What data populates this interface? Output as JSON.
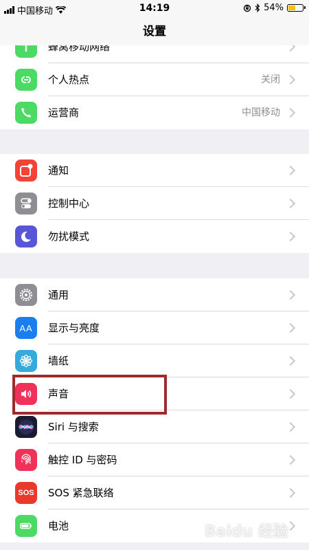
{
  "status_bar": {
    "carrier": "中国移动",
    "time": "14:19",
    "battery_percent": "54%",
    "battery_level": 0.54
  },
  "nav": {
    "title": "设置"
  },
  "groups": [
    {
      "items": [
        {
          "label": "蜂窝移动网络",
          "value": "",
          "icon": "cellular-icon",
          "color": "#4cd964"
        },
        {
          "label": "个人热点",
          "value": "关闭",
          "icon": "hotspot-icon",
          "color": "#4cd964"
        },
        {
          "label": "运营商",
          "value": "中国移动",
          "icon": "phone-icon",
          "color": "#4cd964"
        }
      ]
    },
    {
      "items": [
        {
          "label": "通知",
          "value": "",
          "icon": "notifications-icon",
          "color": "#f44336"
        },
        {
          "label": "控制中心",
          "value": "",
          "icon": "control-center-icon",
          "color": "#8e8e93"
        },
        {
          "label": "勿扰模式",
          "value": "",
          "icon": "moon-icon",
          "color": "#5856d6"
        }
      ]
    },
    {
      "items": [
        {
          "label": "通用",
          "value": "",
          "icon": "gear-icon",
          "color": "#8e8e93"
        },
        {
          "label": "显示与亮度",
          "value": "",
          "icon": "display-icon",
          "color": "#1a7df0"
        },
        {
          "label": "墙纸",
          "value": "",
          "icon": "wallpaper-icon",
          "color": "#35aadc"
        },
        {
          "label": "声音",
          "value": "",
          "icon": "speaker-icon",
          "color": "#f0325a"
        },
        {
          "label": "Siri 与搜索",
          "value": "",
          "icon": "siri-icon",
          "color": "#1b1b2f"
        },
        {
          "label": "触控 ID 与密码",
          "value": "",
          "icon": "fingerprint-icon",
          "color": "#f0325a"
        },
        {
          "label": "SOS 紧急联络",
          "value": "",
          "icon": "sos-icon",
          "color": "#e8392c"
        },
        {
          "label": "电池",
          "value": "",
          "icon": "battery-icon",
          "color": "#4cd964"
        }
      ]
    }
  ],
  "icon_text": {
    "display": "AA",
    "sos": "SOS"
  },
  "watermark": "Baidu 经验"
}
